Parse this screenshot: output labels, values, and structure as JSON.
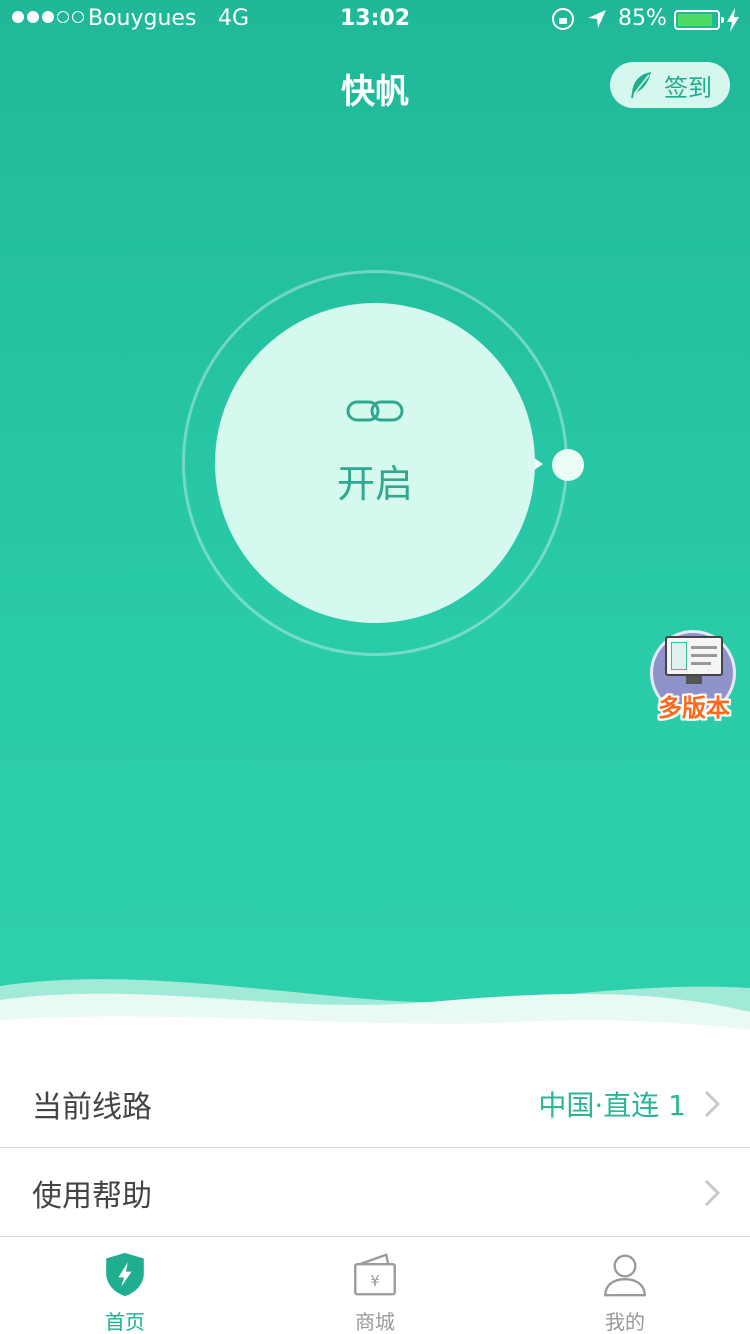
{
  "status_bar": {
    "carrier": "Bouygues",
    "network": "4G",
    "time": "13:02",
    "battery": "85%",
    "battery_level": 0.85,
    "signal_bars_filled": 3,
    "signal_bars_total": 5,
    "icons": [
      "signal-dots-icon",
      "rotation-lock-icon",
      "location-arrow-icon",
      "battery-icon",
      "charging-bolt-icon"
    ]
  },
  "header": {
    "title": "快帆",
    "signin_label": "签到",
    "signin_icon": "feather-icon"
  },
  "power": {
    "label": "开启",
    "icon": "link-icon"
  },
  "badge": {
    "label": "多版本",
    "icon": "monitor-icon"
  },
  "list": {
    "route_label": "当前线路",
    "route_value": "中国·直连 1",
    "help_label": "使用帮助"
  },
  "tabs": [
    {
      "label": "首页",
      "icon": "shield-bolt-icon",
      "active": true
    },
    {
      "label": "商城",
      "icon": "wallet-yen-icon",
      "active": false
    },
    {
      "label": "我的",
      "icon": "user-icon",
      "active": false
    }
  ],
  "colors": {
    "primary": "#1fb898",
    "primary_light": "#d6f9ef",
    "accent_text": "#2bb596",
    "badge_orange": "#ff6a1a"
  }
}
